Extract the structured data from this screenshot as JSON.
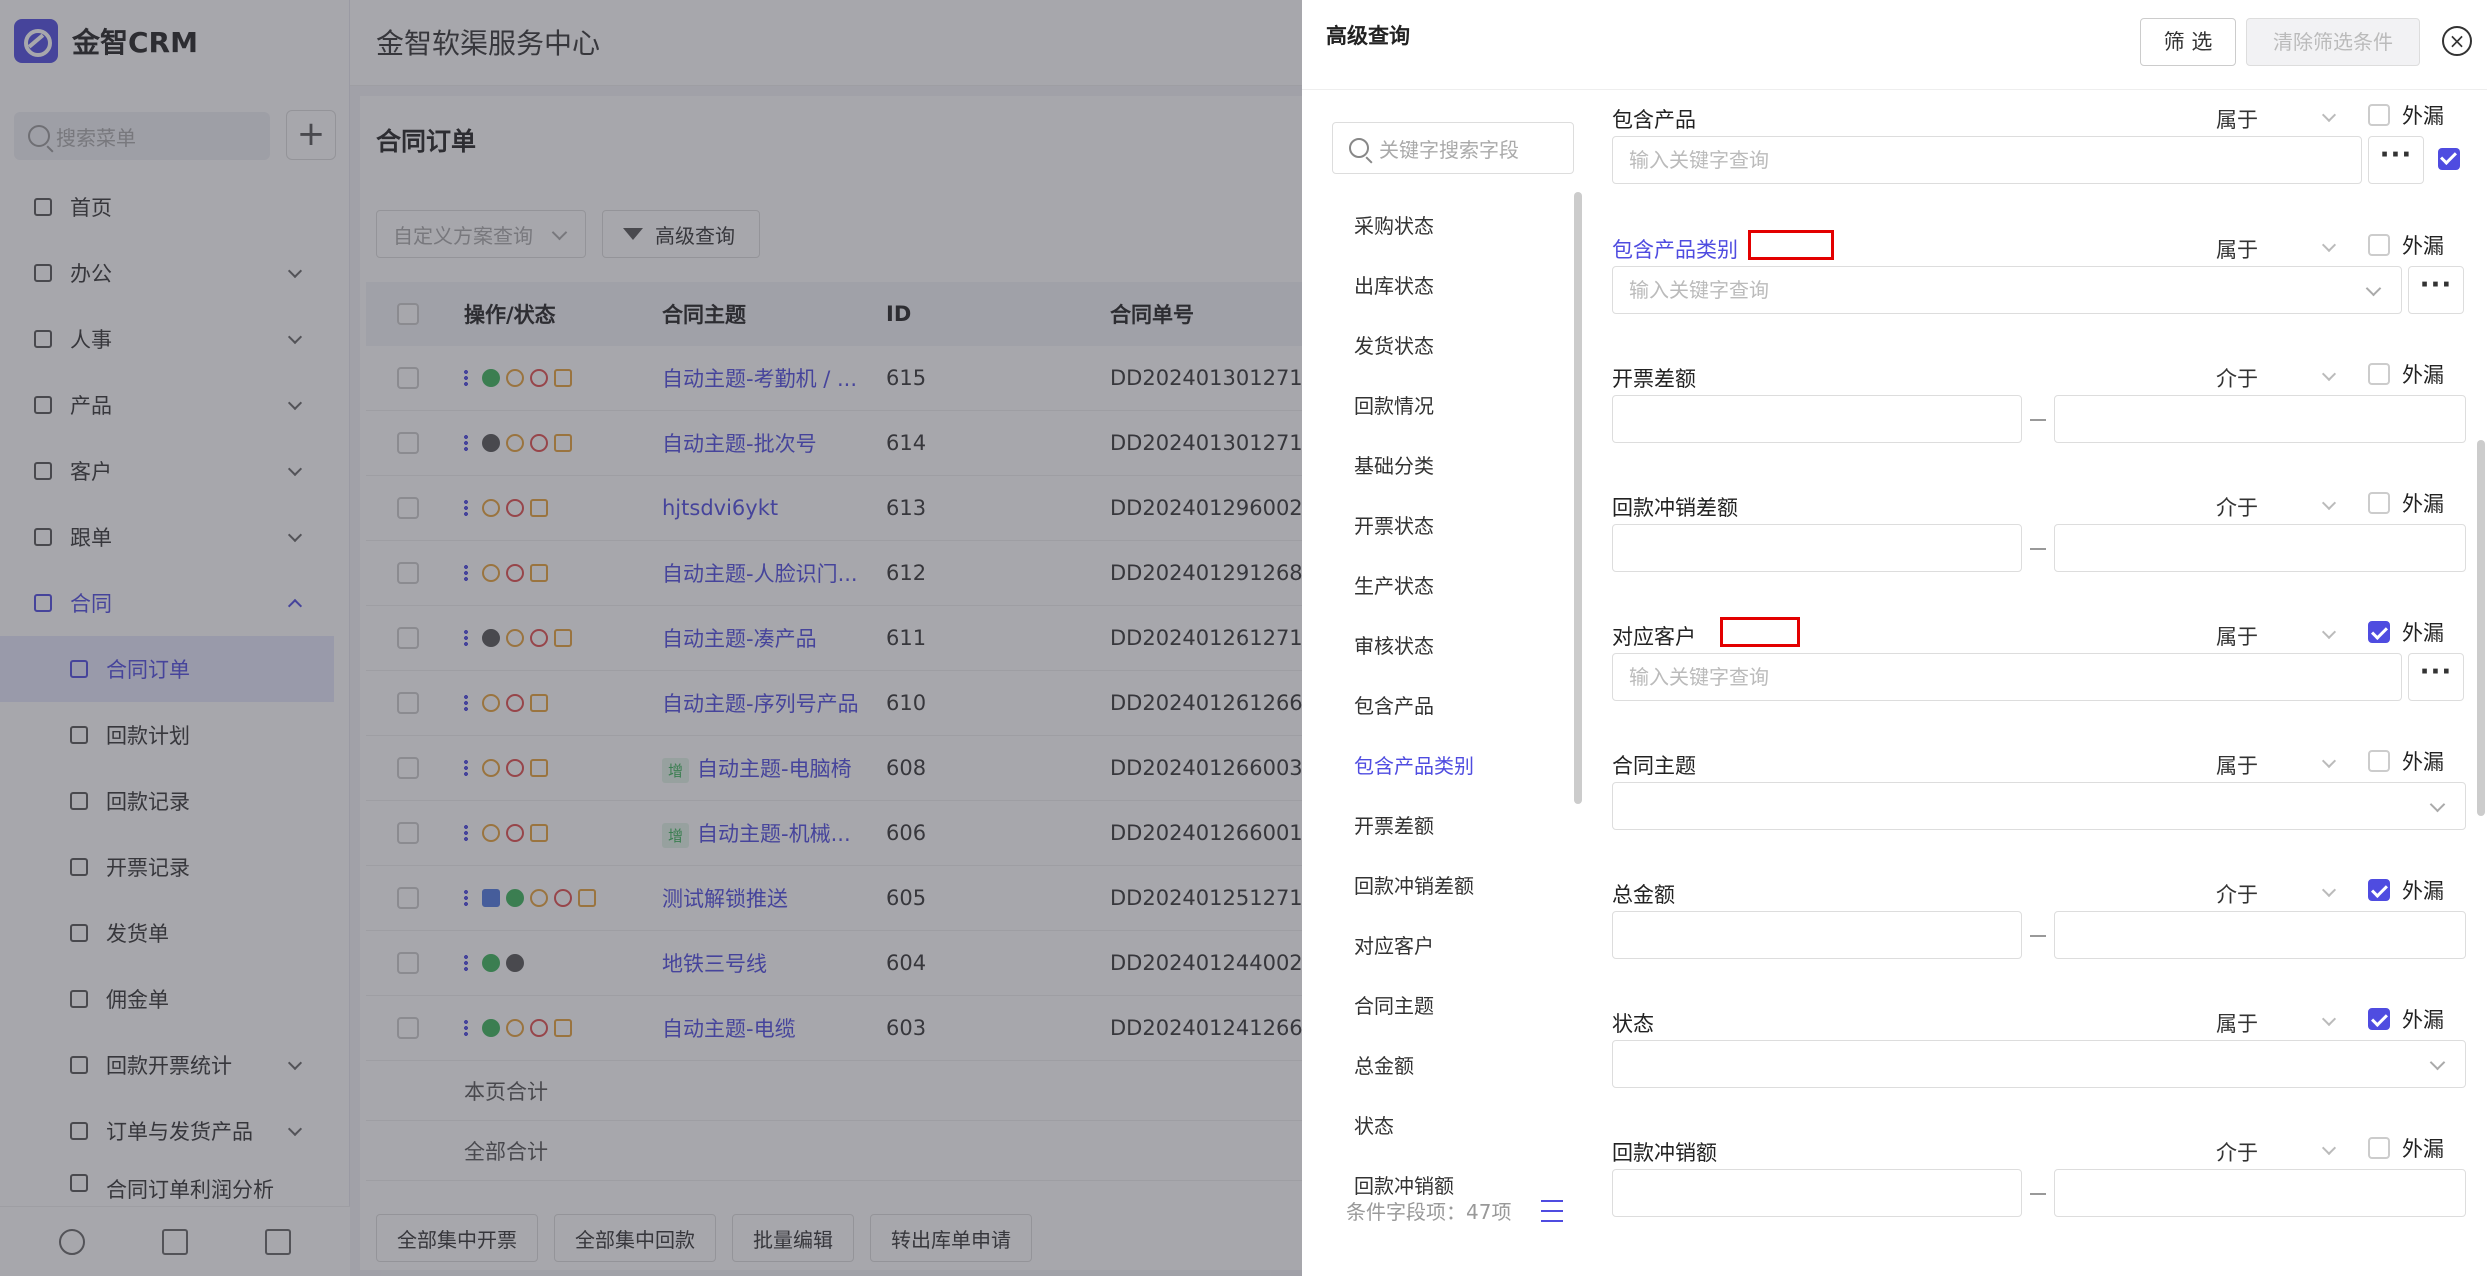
{
  "app": {
    "logo_text": "金智CRM",
    "brand_color": "#4f4ce0",
    "top_title": "金智软渠服务中心"
  },
  "sidebar": {
    "search_placeholder": "搜索菜单",
    "add_icon": "+",
    "items": [
      {
        "label": "首页",
        "icon": "home-icon"
      },
      {
        "label": "办公",
        "icon": "monitor-icon"
      },
      {
        "label": "人事",
        "icon": "person-icon"
      },
      {
        "label": "产品",
        "icon": "cube-icon"
      },
      {
        "label": "客户",
        "icon": "chart-icon"
      },
      {
        "label": "跟单",
        "icon": "target-icon"
      },
      {
        "label": "合同",
        "icon": "contract-icon"
      }
    ],
    "sub_items": [
      {
        "label": "合同订单"
      },
      {
        "label": "回款计划"
      },
      {
        "label": "回款记录"
      },
      {
        "label": "开票记录"
      },
      {
        "label": "发货单"
      },
      {
        "label": "佣金单"
      },
      {
        "label": "回款开票统计"
      },
      {
        "label": "订单与发货产品"
      },
      {
        "label": "合同订单利润分析"
      }
    ]
  },
  "page": {
    "title": "合同订单",
    "scheme_placeholder": "自定义方案查询",
    "advanced_query": "高级查询",
    "columns": [
      "操作/状态",
      "合同主题",
      "ID",
      "合同单号"
    ],
    "rows": [
      {
        "subject": "自动主题-考勤机 / ...",
        "id": "615",
        "no": "DD202401301271..."
      },
      {
        "subject": "自动主题-批次号",
        "id": "614",
        "no": "DD202401301271..."
      },
      {
        "subject": "hjtsdvi6ykt",
        "id": "613",
        "no": "DD202401296002"
      },
      {
        "subject": "自动主题-人脸识门...",
        "id": "612",
        "no": "DD202401291268..."
      },
      {
        "subject": "自动主题-凑产品",
        "id": "611",
        "no": "DD202401261271..."
      },
      {
        "subject": "自动主题-序列号产品",
        "id": "610",
        "no": "DD202401261266..."
      },
      {
        "tag": "增",
        "subject": "自动主题-电脑椅",
        "id": "608",
        "no": "DD202401266003"
      },
      {
        "tag": "增",
        "subject": "自动主题-机械...",
        "id": "606",
        "no": "DD202401266001"
      },
      {
        "subject": "测试解锁推送",
        "id": "605",
        "no": "DD202401251271..."
      },
      {
        "subject": "地铁三号线",
        "id": "604",
        "no": "DD202401244002"
      },
      {
        "subject": "自动主题-电缆",
        "id": "603",
        "no": "DD202401241266..."
      }
    ],
    "page_total": "本页合计",
    "all_total": "全部合计",
    "bottom_buttons": [
      "全部集中开票",
      "全部集中回款",
      "批量编辑",
      "转出库单申请"
    ]
  },
  "drawer": {
    "title": "高级查询",
    "filter_button": "筛 选",
    "clear_button": "清除筛选条件",
    "field_search_placeholder": "关键字搜索字段",
    "field_list": [
      "采购状态",
      "出库状态",
      "发货状态",
      "回款情况",
      "基础分类",
      "开票状态",
      "生产状态",
      "审核状态",
      "包含产品",
      "包含产品类别",
      "开票差额",
      "回款冲销差额",
      "对应客户",
      "合同主题",
      "总金额",
      "状态",
      "回款冲销额"
    ],
    "active_field": "包含产品类别",
    "field_count_label": "条件字段项：47项",
    "conditions": [
      {
        "label": "包含产品",
        "op": "属于",
        "ext": "外漏",
        "placeholder": "输入关键字查询",
        "checked": false
      },
      {
        "label": "包含产品类别",
        "op": "属于",
        "ext": "外漏",
        "placeholder": "输入关键字查询",
        "checked": false
      },
      {
        "label": "开票差额",
        "op": "介于",
        "ext": "外漏",
        "checked": false
      },
      {
        "label": "回款冲销差额",
        "op": "介于",
        "ext": "外漏",
        "checked": false
      },
      {
        "label": "对应客户",
        "op": "属于",
        "ext": "外漏",
        "placeholder": "输入关键字查询",
        "checked": true
      },
      {
        "label": "合同主题",
        "op": "属于",
        "ext": "外漏",
        "checked": false
      },
      {
        "label": "总金额",
        "op": "介于",
        "ext": "外漏",
        "checked": true
      },
      {
        "label": "状态",
        "op": "属于",
        "ext": "外漏",
        "checked": true
      },
      {
        "label": "回款冲销额",
        "op": "介于",
        "ext": "外漏",
        "checked": false
      }
    ],
    "dots": "···",
    "range_sep": "—",
    "close_icon": "×"
  }
}
